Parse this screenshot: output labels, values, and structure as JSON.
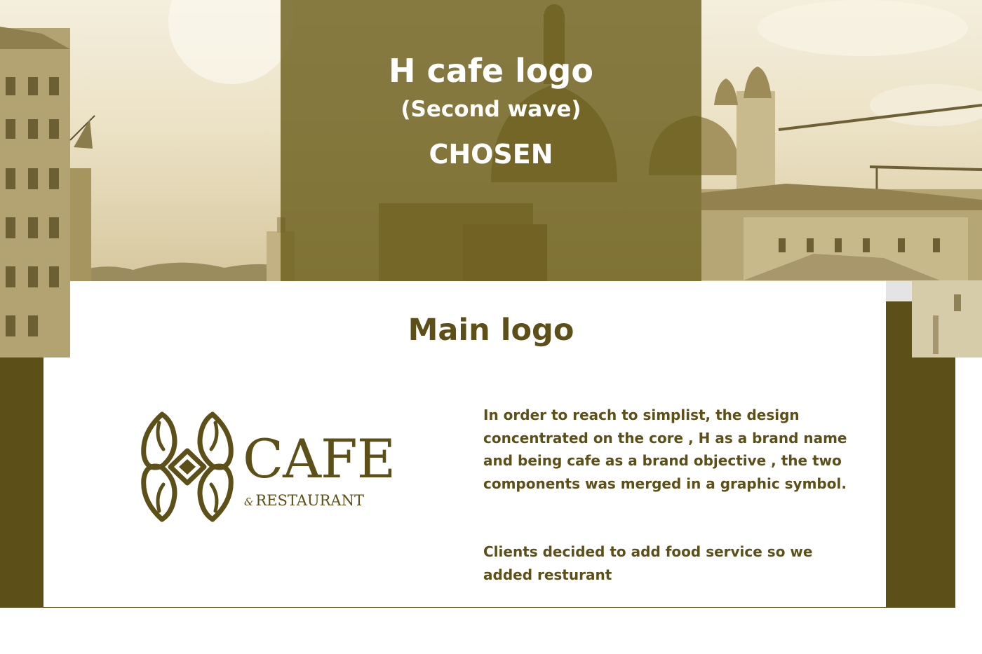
{
  "header": {
    "title": "H cafe logo",
    "subtitle": "(Second wave)",
    "status": "CHOSEN"
  },
  "section": {
    "title": "Main logo"
  },
  "logo": {
    "icon": "h-coffee-bean-monogram-icon",
    "word": "CAFE",
    "ampersand": "&",
    "tagline": "RESTAURANT"
  },
  "description": {
    "paragraph_1": "In order to reach to simplist, the design concentrated on the core , H as a brand name and being cafe as a brand objective , the two components was merged in a graphic symbol.",
    "paragraph_2": "Clients decided to add food service so we added resturant"
  },
  "colors": {
    "olive_dark": "#5c4f18",
    "olive_panel": "#6a5d1a",
    "sepia_light": "#ece2c6",
    "white": "#ffffff"
  }
}
